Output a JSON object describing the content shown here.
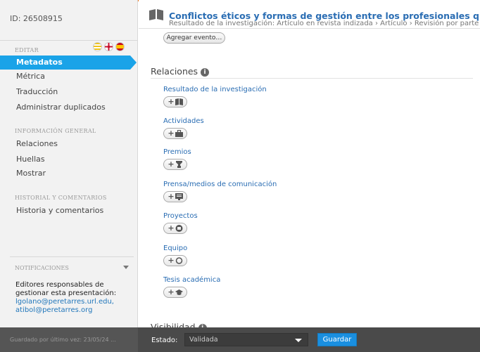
{
  "sidebar": {
    "record_id": "ID: 26508915",
    "edit_section": "EDITAR",
    "edit_items": [
      "Metadatos",
      "Métrica",
      "Traducción",
      "Administrar duplicados"
    ],
    "general_section": "INFORMACIÓN GENERAL",
    "general_items": [
      "Relaciones",
      "Huellas",
      "Mostrar"
    ],
    "history_section": "HISTORIAL Y COMENTARIOS",
    "history_items": [
      "Historia y comentarios"
    ],
    "notifications": {
      "title": "NOTIFICACIONES",
      "text": "Editores responsables de gestionar esta presentación:",
      "emails": "lgolano@peretarres.url.edu, atibol@peretarres.org"
    }
  },
  "header": {
    "title": "Conflictos éticos y formas de gestión entre los profesionales que trabajan en el á",
    "subtitle": "Resultado de la investigación: Artículo en revista indizada › Artículo › Revisión por parte de"
  },
  "content": {
    "add_event_label": "Agregar evento…",
    "relations_title": "Relaciones",
    "relations": [
      {
        "label": "Resultado de la investigación",
        "icon": "book-icon"
      },
      {
        "label": "Actividades",
        "icon": "briefcase-icon"
      },
      {
        "label": "Premios",
        "icon": "trophy-icon"
      },
      {
        "label": "Prensa/medios de comunicación",
        "icon": "media-icon"
      },
      {
        "label": "Proyectos",
        "icon": "project-icon"
      },
      {
        "label": "Equipo",
        "icon": "equipment-icon"
      },
      {
        "label": "Tesis académica",
        "icon": "graduation-icon"
      }
    ],
    "visibility_title": "Visibilidad"
  },
  "footer": {
    "saved": "Guardado por último vez: 23/05/24 ...",
    "estado_label": "Estado:",
    "estado_value": "Validada",
    "save_label": "Guardar"
  },
  "colors": {
    "accent": "#1aa3e8",
    "title": "#2a6db3",
    "frame": "#f07c24"
  }
}
